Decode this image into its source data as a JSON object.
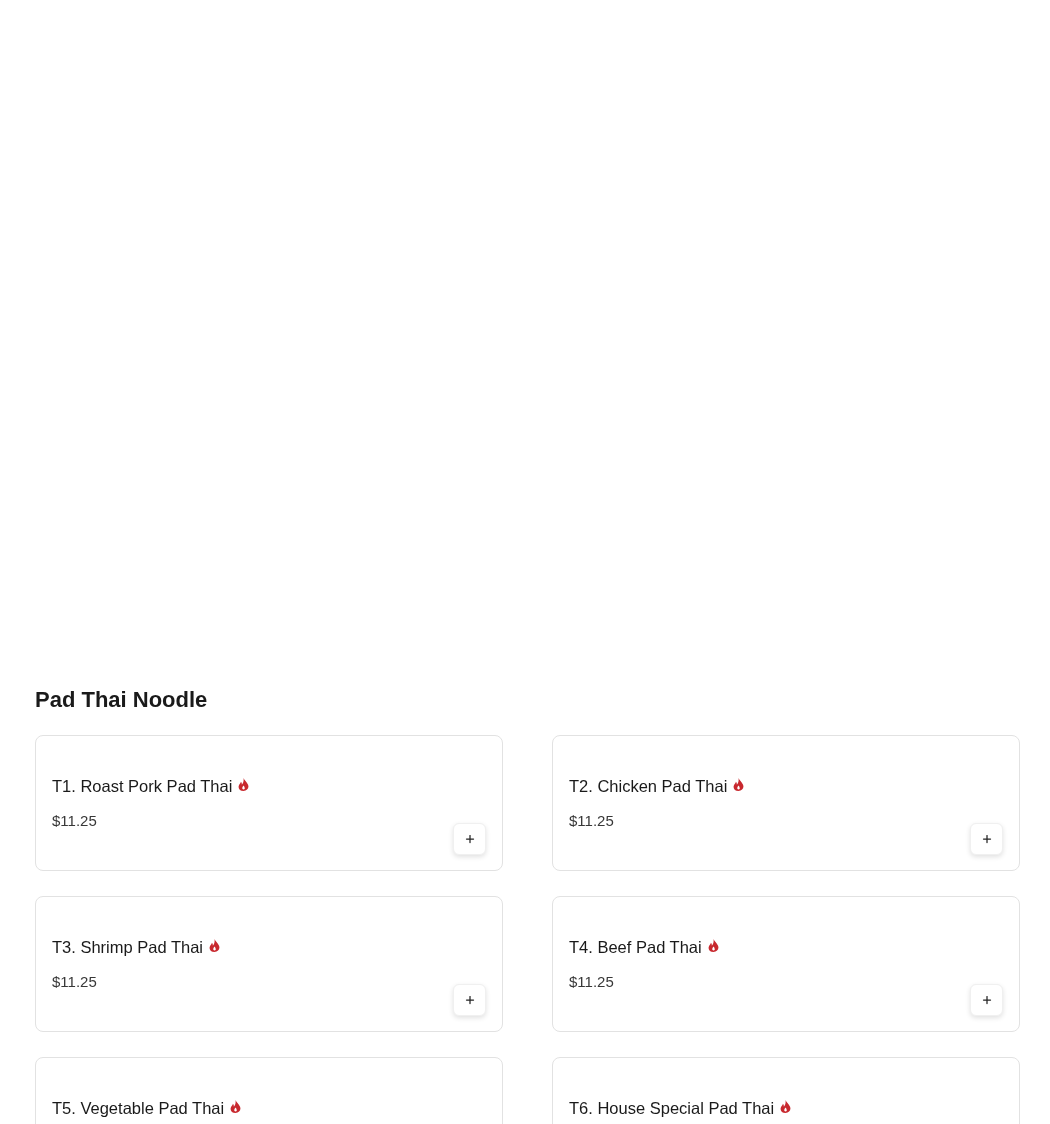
{
  "section": {
    "title": "Pad Thai Noodle",
    "items": [
      {
        "name": "T1. Roast Pork Pad Thai",
        "spicy": true,
        "price": "$11.25"
      },
      {
        "name": "T2. Chicken Pad Thai",
        "spicy": true,
        "price": "$11.25"
      },
      {
        "name": "T3. Shrimp Pad Thai",
        "spicy": true,
        "price": "$11.25"
      },
      {
        "name": "T4. Beef Pad Thai",
        "spicy": true,
        "price": "$11.25"
      },
      {
        "name": "T5. Vegetable Pad Thai",
        "spicy": true
      },
      {
        "name": "T6. House Special Pad Thai",
        "spicy": true
      }
    ]
  }
}
